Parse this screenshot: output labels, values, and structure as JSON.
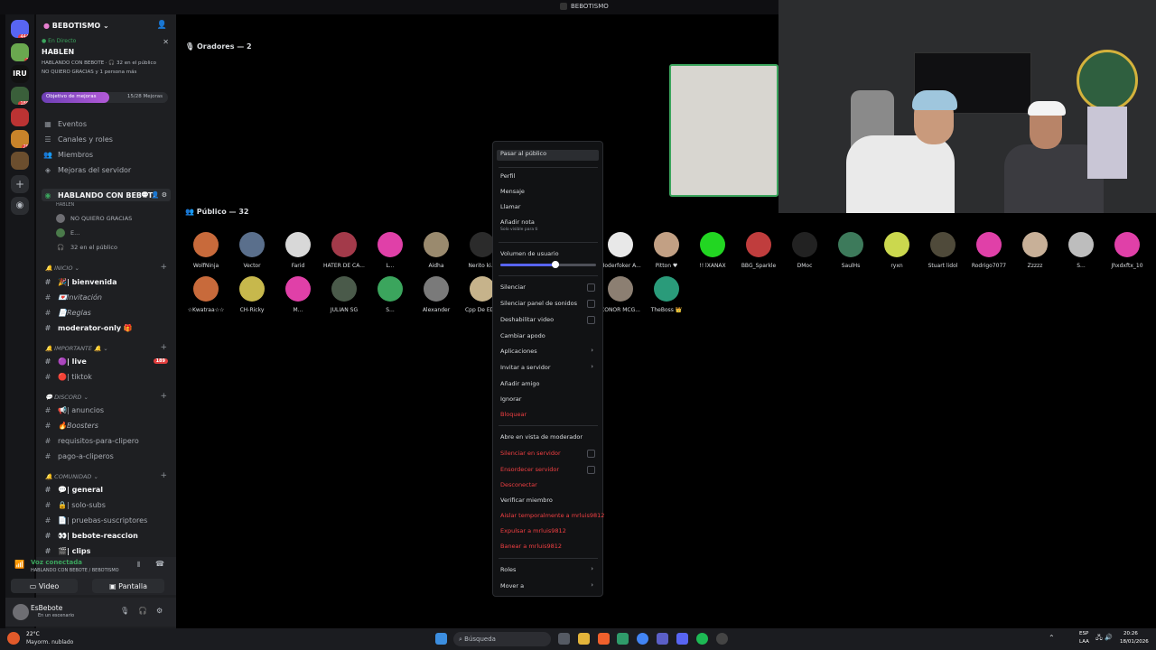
{
  "window_title": "BEBOTISMO",
  "rail": {
    "badges": [
      "444",
      "2",
      "189",
      "28"
    ],
    "iru_label": "IRU"
  },
  "server": {
    "name": "BEBOTISMO",
    "live_label": "En Directo",
    "stage_name": "HABLEN",
    "live_line1": "HABLANDO CON BEBOTE · 🎧 32 en el público",
    "live_line2": "NO QUIERO GRACIAS y 1 persona más",
    "goal_label": "Objetivo de mejoras",
    "goal_value": "15/28 Mejoras",
    "goal_fraction": 0.536
  },
  "sidebar": {
    "nav": [
      "Eventos",
      "Canales y roles",
      "Miembros",
      "Mejoras del servidor"
    ],
    "voice_channel": {
      "name": "HABLANDO CON BEBOTE",
      "sub": "HABLEN"
    },
    "voice_members": [
      "NO QUIERO GRACIAS",
      "E...",
      "32 en el público"
    ],
    "categories": {
      "inicio": "INICIO",
      "importante": "IMPORTANTE 🔔",
      "discord": "DISCORD",
      "comunidad": "COMUNIDAD"
    },
    "channels": {
      "bienvenida": "| bienvenida",
      "invitacion": "Invitación",
      "reglas": "Reglas",
      "moderator": "moderator-only 🎁",
      "live": "| live",
      "live_badge": "189",
      "tiktok": "| tiktok",
      "anuncios": "| anuncios",
      "boosters": "Boosters",
      "requisitos": "requisitos-para-clipero",
      "pago": "pago-a-cliperos",
      "general": "| general",
      "solosubs": "| solo-subs",
      "pruebas": "| pruebas-suscriptores",
      "reaccion": "| bebote-reaccion",
      "clips": "| clips"
    }
  },
  "voice_panel": {
    "status": "Voz conectada",
    "location": "HABLANDO CON BEBOTE / BEBOTISMO",
    "video": "Video",
    "screen": "Pantalla"
  },
  "user": {
    "name": "EsBebote",
    "status": "En un escenario"
  },
  "stage": {
    "speakers": "Oradores — 2",
    "audience": "Público — 32",
    "audience_row1": [
      "WolfNinja",
      "Vector",
      "Farid",
      "HATER DE CA...",
      "L...",
      "Aidha",
      "Nerito ki...",
      "",
      "",
      "Moderfoker A...",
      "Pitton ♥",
      "!! lXANAX",
      "BBG_Sparkle",
      "DMoc",
      "SaulHs",
      "ryxn",
      "Stuart lidol",
      "Rodrigo7077",
      "Zzzzz",
      "S...",
      "Jhxdxftx_10"
    ],
    "audience_row2": [
      "☆Kwatraa☆☆",
      "CH-Ricky",
      "M...",
      "JULIAN SG",
      "S...",
      "Alexander",
      "Cpp De ED...",
      "",
      "",
      "CONOR MCG...",
      "TheBoss 👑"
    ]
  },
  "context_menu": {
    "items": {
      "move_public": "Pasar al público",
      "profile": "Perfil",
      "message": "Mensaje",
      "call": "Llamar",
      "note": "Añadir nota",
      "note_sub": "Solo visible para ti",
      "volume": "Volumen de usuario",
      "mute": "Silenciar",
      "mute_soundboard": "Silenciar panel de sonidos",
      "disable_video": "Deshabilitar video",
      "change_nick": "Cambiar apodo",
      "apps": "Aplicaciones",
      "invite": "Invitar a servidor",
      "add_friend": "Añadir amigo",
      "ignore": "Ignorar",
      "block": "Bloquear",
      "mod_view": "Abre en vista de moderador",
      "server_mute": "Silenciar en servidor",
      "server_deafen": "Ensordecer servidor",
      "disconnect": "Desconectar",
      "verify": "Verificar miembro",
      "timeout": "Aislar temporalmente a mrluis9812",
      "kick": "Expulsar a mrluis9812",
      "ban": "Banear a mrluis9812",
      "roles": "Roles",
      "move_to": "Mover a"
    },
    "volume_fraction": 0.58
  },
  "taskbar": {
    "weather_temp": "22°C",
    "weather_desc": "Mayorm. nublado",
    "search": "Búsqueda",
    "lang1": "ESP",
    "lang2": "LAA",
    "time": "20:26",
    "date": "18/01/2026"
  },
  "colors": {
    "accent": "#5865f2",
    "danger": "#f23f42",
    "online": "#3ba55d",
    "goal": "#b35ad8"
  }
}
